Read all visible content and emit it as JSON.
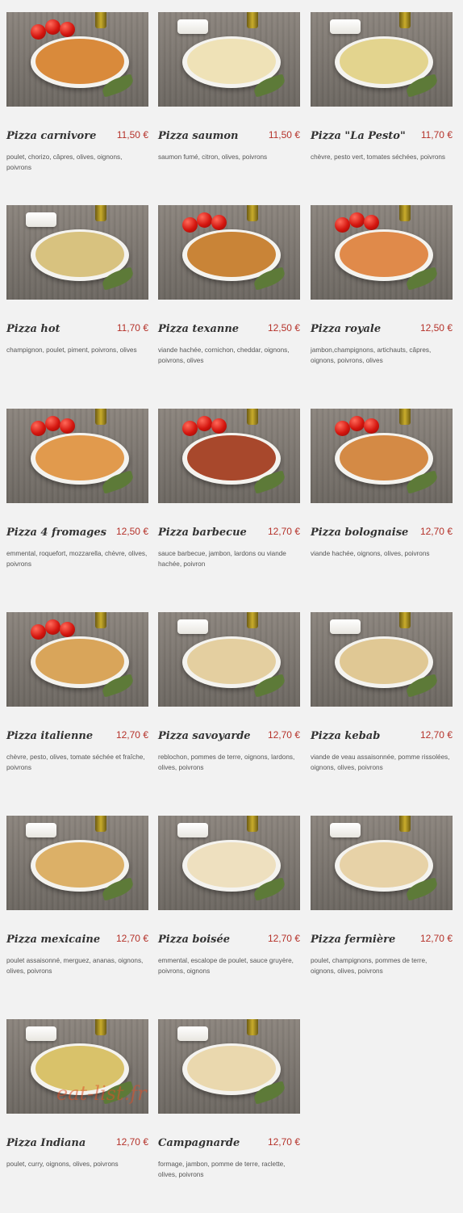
{
  "currency_note": "€",
  "items": [
    {
      "name": "Pizza carnivore",
      "price": "11,50 €",
      "description": "poulet, chorizo, câpres, olives, oignons, poivrons",
      "garnish": "tomatoes",
      "color": "#d98a3b"
    },
    {
      "name": "Pizza saumon",
      "price": "11,50 €",
      "description": "saumon fumé, citron, olives, poivrons",
      "garnish": "sauce",
      "color": "#efe2b7"
    },
    {
      "name": "Pizza \"La Pesto\"",
      "price": "11,70 €",
      "description": "chèvre, pesto vert, tomates séchées, poivrons",
      "garnish": "sauce",
      "color": "#e3d48e"
    },
    {
      "name": "Pizza hot",
      "price": "11,70 €",
      "description": "champignon, poulet, piment, poivrons, olives",
      "garnish": "sauce",
      "color": "#d8c27f"
    },
    {
      "name": "Pizza texanne",
      "price": "12,50 €",
      "description": "viande hachée, cornichon, cheddar, oignons, poivrons, olives",
      "garnish": "tomatoes",
      "color": "#c98437"
    },
    {
      "name": "Pizza royale",
      "price": "12,50 €",
      "description": "jambon,champignons, artichauts, câpres, oignons, poivrons, olives",
      "garnish": "tomatoes",
      "color": "#e08a4a"
    },
    {
      "name": "Pizza 4 fromages",
      "price": "12,50 €",
      "description": "emmental, roquefort, mozzarella, chèvre, olives, poivrons",
      "garnish": "tomatoes",
      "color": "#e19a4d"
    },
    {
      "name": "Pizza barbecue",
      "price": "12,70 €",
      "description": "sauce barbecue, jambon, lardons ou viande hachée, poivron",
      "garnish": "tomatoes",
      "color": "#a8482c"
    },
    {
      "name": "Pizza bolognaise",
      "price": "12,70 €",
      "description": "viande hachée, oignons, olives, poivrons",
      "garnish": "tomatoes",
      "color": "#d48a45"
    },
    {
      "name": "Pizza italienne",
      "price": "12,70 €",
      "description": "chèvre, pesto, olives, tomate séchée et fraîche, poivrons",
      "garnish": "tomatoes",
      "color": "#d9a55a"
    },
    {
      "name": "Pizza savoyarde",
      "price": "12,70 €",
      "description": "reblochon, pommes de terre, oignons, lardons, olives, poivrons",
      "garnish": "sauce",
      "color": "#e4cfa0"
    },
    {
      "name": "Pizza kebab",
      "price": "12,70 €",
      "description": "viande de veau assaisonnée, pomme rissolées, oignons, olives, poivrons",
      "garnish": "sauce",
      "color": "#e0c894"
    },
    {
      "name": "Pizza mexicaine",
      "price": "12,70 €",
      "description": "poulet assaisonné, merguez, ananas, oignons, olives, poivrons",
      "garnish": "sauce",
      "color": "#dcb067"
    },
    {
      "name": "Pizza boisée",
      "price": "12,70 €",
      "description": "emmental, escalope de poulet, sauce gruyère, poivrons, oignons",
      "garnish": "sauce",
      "color": "#eee0bf"
    },
    {
      "name": "Pizza fermière",
      "price": "12,70 €",
      "description": "poulet, champignons, pommes de terre, oignons, olives, poivrons",
      "garnish": "sauce",
      "color": "#e7d2a7"
    },
    {
      "name": "Pizza Indiana",
      "price": "12,70 €",
      "description": "poulet, curry, oignons, olives, poivrons",
      "garnish": "sauce",
      "color": "#d9c26a"
    },
    {
      "name": "Campagnarde",
      "price": "12,70 €",
      "description": "formage, jambon, pomme de terre, raclette, olives, poivrons",
      "garnish": "sauce",
      "color": "#ead8ae"
    }
  ],
  "watermark": "eat-list.fr"
}
